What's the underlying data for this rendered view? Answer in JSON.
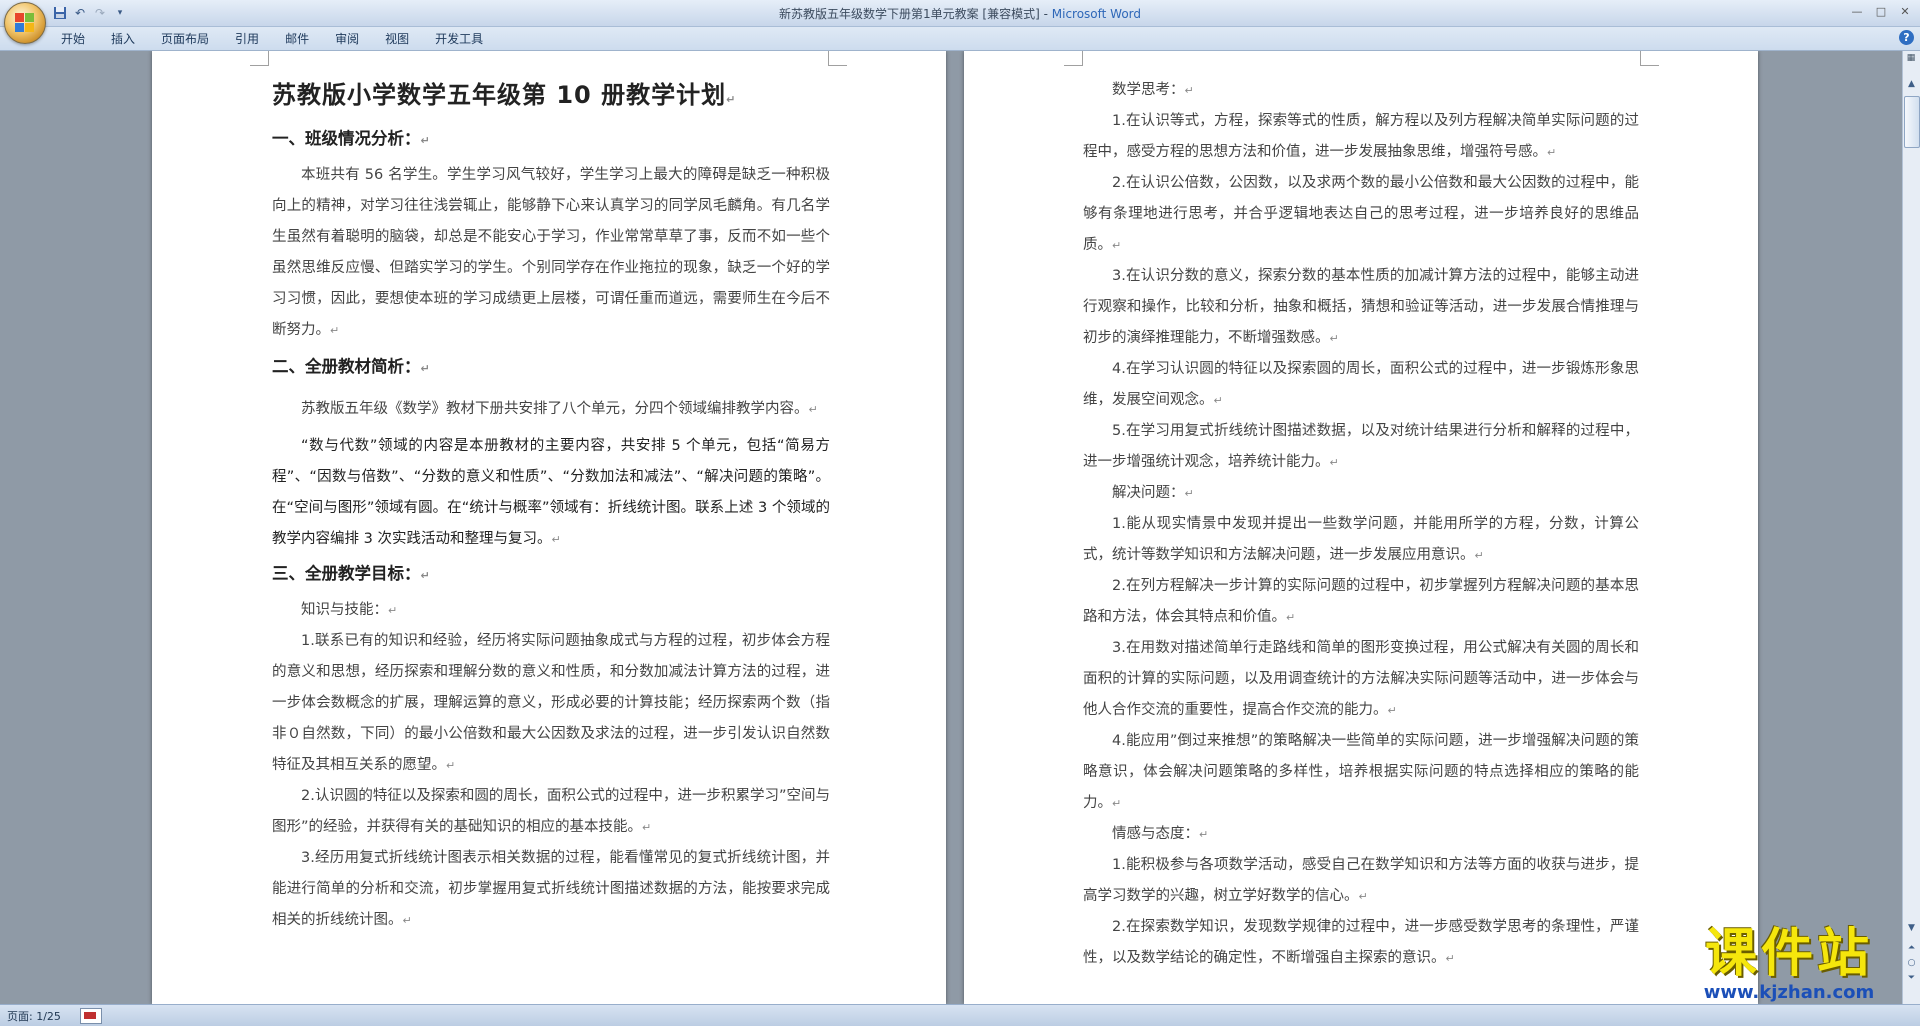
{
  "window": {
    "title": "新苏教版五年级数学下册第1单元教案 [兼容模式] - ",
    "app_name": "Microsoft Word",
    "controls": [
      "—",
      "□",
      "✕"
    ]
  },
  "quick_access": {
    "save_icon": "save-icon",
    "undo_icon": "undo-icon",
    "redo_icon": "redo-icon",
    "customize_icon": "dropdown-icon"
  },
  "ribbon": {
    "tabs": [
      "开始",
      "插入",
      "页面布局",
      "引用",
      "邮件",
      "审阅",
      "视图",
      "开发工具"
    ],
    "help": "?"
  },
  "page_left": {
    "title": "苏教版小学数学五年级第 10 册教学计划",
    "sections": [
      {
        "heading": "一、班级情况分析："
      },
      {
        "heading": "二、全册教材简析："
      },
      {
        "heading": "三、全册教学目标："
      }
    ],
    "p1": "本班共有 56 名学生。学生学习风气较好，学生学习上最大的障碍是缺乏一种积极向上的精神，对学习往往浅尝辄止，能够静下心来认真学习的同学凤毛麟角。有几名学生虽然有着聪明的脑袋，却总是不能安心于学习，作业常常草草了事，反而不如一些个虽然思维反应慢、但踏实学习的学生。个别同学存在作业拖拉的现象，缺乏一个好的学习习惯，因此，要想使本班的学习成绩更上层楼，可谓任重而道远，需要师生在今后不断努力。",
    "p2": "苏教版五年级《数学》教材下册共安排了八个单元，分四个领域编排教学内容。",
    "p3": "“数与代数”领域的内容是本册教材的主要内容，共安排 5 个单元，包括“简易方程”、“因数与倍数”、“分数的意义和性质”、“分数加法和减法”、“解决问题的策略”。 在“空间与图形”领域有圆。在“统计与概率”领域有：折线统计图。联系上述 3 个领域的教学内容编排 3 次实践活动和整理与复习。",
    "p4": "知识与技能：",
    "p5": "1.联系已有的知识和经验，经历将实际问题抽象成式与方程的过程，初步体会方程的意义和思想，经历探索和理解分数的意义和性质，和分数加减法计算方法的过程，进一步体会数概念的扩展，理解运算的意义，形成必要的计算技能；经历探索两个数（指非０自然数，下同）的最小公倍数和最大公因数及求法的过程，进一步引发认识自然数特征及其相互关系的愿望。",
    "p6": "2.认识圆的特征以及探索和圆的周长，面积公式的过程中，进一步积累学习”空间与图形”的经验，并获得有关的基础知识的相应的基本技能。",
    "p7": "3.经历用复式折线统计图表示相关数据的过程，能看懂常见的复式折线统计图，并能进行简单的分析和交流，初步掌握用复式折线统计图描述数据的方法，能按要求完成相关的折线统计图。"
  },
  "page_right": {
    "r1": "数学思考：",
    "r2": "1.在认识等式，方程，探索等式的性质，解方程以及列方程解决简单实际问题的过程中，感受方程的思想方法和价值，进一步发展抽象思维，增强符号感。",
    "r3": "2.在认识公倍数，公因数，以及求两个数的最小公倍数和最大公因数的过程中，能够有条理地进行思考，并合乎逻辑地表达自己的思考过程，进一步培养良好的思维品质。",
    "r4": "3.在认识分数的意义，探索分数的基本性质的加减计算方法的过程中，能够主动进行观察和操作，比较和分析，抽象和概括，猜想和验证等活动，进一步发展合情推理与初步的演绎推理能力，不断增强数感。",
    "r5": "4.在学习认识圆的特征以及探索圆的周长，面积公式的过程中，进一步锻炼形象思维，发展空间观念。",
    "r6": "5.在学习用复式折线统计图描述数据，以及对统计结果进行分析和解释的过程中，进一步增强统计观念，培养统计能力。",
    "r7": "解决问题：",
    "r8": "1.能从现实情景中发现并提出一些数学问题，并能用所学的方程，分数，计算公式，统计等数学知识和方法解决问题，进一步发展应用意识。",
    "r9": "2.在列方程解决一步计算的实际问题的过程中，初步掌握列方程解决问题的基本思路和方法，体会其特点和价值。",
    "r10": "3.在用数对描述简单行走路线和简单的图形变换过程，用公式解决有关圆的周长和面积的计算的实际问题，以及用调查统计的方法解决实际问题等活动中，进一步体会与他人合作交流的重要性，提高合作交流的能力。",
    "r11": "4.能应用”倒过来推想”的策略解决一些简单的实际问题，进一步增强解决问题的策略意识，体会解决问题策略的多样性，培养根据实际问题的特点选择相应的策略的能力。",
    "r12": "情感与态度：",
    "r13": "1.能积极参与各项数学活动，感受自己在数学知识和方法等方面的收获与进步，提高学习数学的兴趣，树立学好数学的信心。",
    "r14": "2.在探索数学知识，发现数学规律的过程中，进一步感受数学思考的条理性，严谨性，以及数学结论的确定性，不断增强自主探索的意识。"
  },
  "paragraph_mark": "↵",
  "statusbar": {
    "page": "页面: 1/25"
  },
  "watermark": {
    "logo": "课件站",
    "url": "www.kjzhan.com"
  },
  "colors": {
    "accent": "#2e67b8",
    "watermark_yellow": "#f5e60c",
    "watermark_blue": "#1b4fb8"
  }
}
